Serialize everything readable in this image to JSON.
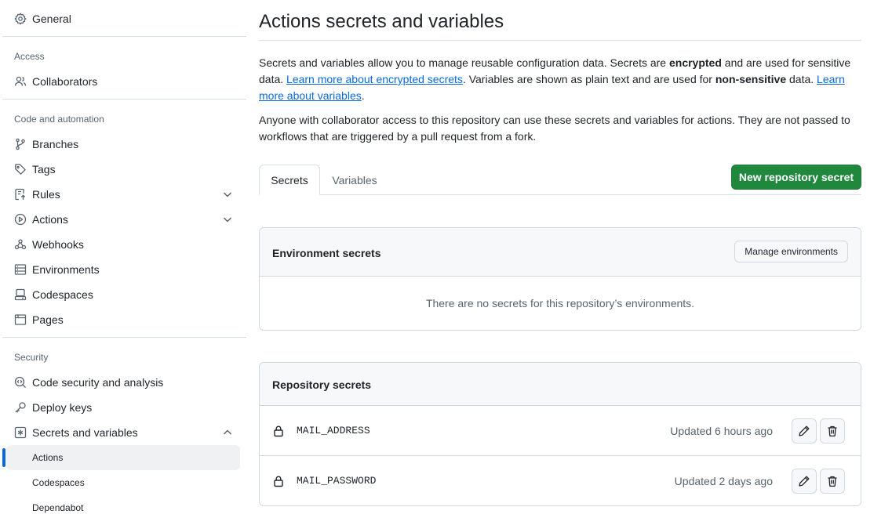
{
  "sidebar": {
    "general": {
      "label": "General",
      "icon": "gear-icon"
    },
    "sections": {
      "access": "Access",
      "code_automation": "Code and automation",
      "security": "Security"
    },
    "collaborators": {
      "label": "Collaborators",
      "icon": "people-icon"
    },
    "branches": {
      "label": "Branches",
      "icon": "git-branch-icon"
    },
    "tags": {
      "label": "Tags",
      "icon": "tag-icon"
    },
    "rules": {
      "label": "Rules",
      "icon": "repo-push-icon"
    },
    "actions": {
      "label": "Actions",
      "icon": "play-icon"
    },
    "webhooks": {
      "label": "Webhooks",
      "icon": "webhook-icon"
    },
    "environments": {
      "label": "Environments",
      "icon": "server-icon"
    },
    "codespaces": {
      "label": "Codespaces",
      "icon": "codespaces-icon"
    },
    "pages": {
      "label": "Pages",
      "icon": "browser-icon"
    },
    "code_security": {
      "label": "Code security and analysis",
      "icon": "codescan-icon"
    },
    "deploy_keys": {
      "label": "Deploy keys",
      "icon": "key-icon"
    },
    "secrets_variables": {
      "label": "Secrets and variables",
      "icon": "asterisk-icon"
    },
    "sub_items": {
      "actions": "Actions",
      "codespaces": "Codespaces",
      "dependabot": "Dependabot"
    }
  },
  "main": {
    "title": "Actions secrets and variables",
    "intro": {
      "part1": "Secrets and variables allow you to manage reusable configuration data. Secrets are ",
      "bold1": "encrypted",
      "part2": " and are used for sensitive data. ",
      "link1": "Learn more about encrypted secrets",
      "part3": ". Variables are shown as plain text and are used for ",
      "bold2": "non-sensitive",
      "part4": " data. ",
      "link2": "Learn more about variables",
      "part5": "."
    },
    "notice": "Anyone with collaborator access to this repository can use these secrets and variables for actions. They are not passed to workflows that are triggered by a pull request from a fork.",
    "tabs": {
      "secrets": "Secrets",
      "variables": "Variables"
    },
    "new_secret_button": "New repository secret",
    "environment_secrets": {
      "title": "Environment secrets",
      "manage_button": "Manage environments",
      "empty_text": "There are no secrets for this repository’s environments."
    },
    "repository_secrets": {
      "title": "Repository secrets",
      "items": [
        {
          "name": "MAIL_ADDRESS",
          "updated": "Updated 6 hours ago"
        },
        {
          "name": "MAIL_PASSWORD",
          "updated": "Updated 2 days ago"
        }
      ]
    }
  },
  "colors": {
    "accent_blue": "#0969da",
    "primary_green": "#1f883d",
    "muted_text": "#59636e",
    "border": "#d1d9e0"
  }
}
